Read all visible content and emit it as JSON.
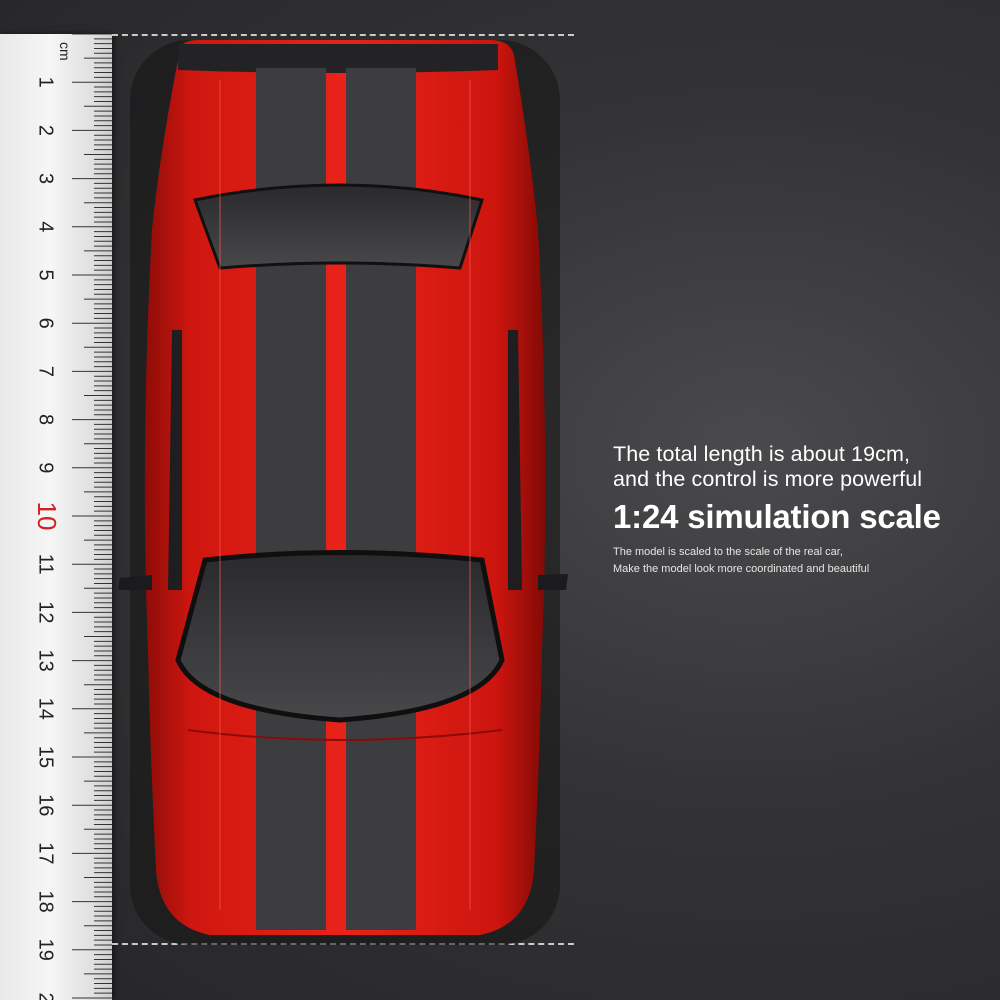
{
  "ruler": {
    "unit": "cm",
    "numbers": [
      "1",
      "2",
      "3",
      "4",
      "5",
      "6",
      "7",
      "8",
      "9",
      "10",
      "11",
      "12",
      "13",
      "14",
      "15",
      "16",
      "17",
      "18",
      "19",
      "2"
    ],
    "highlight_number": "10",
    "highlight_color": "#d42020"
  },
  "headline": {
    "line1": "The total length is about 19cm,",
    "line2": "and the control is more powerful",
    "scale": "1:24 simulation scale",
    "note1": "The model is scaled to the scale of the real car,",
    "note2": "Make the model look more coordinated and beautiful"
  },
  "colors": {
    "car_body": "#e01b14",
    "stripe": "#3d3d3f",
    "background": "#2e2e30"
  }
}
